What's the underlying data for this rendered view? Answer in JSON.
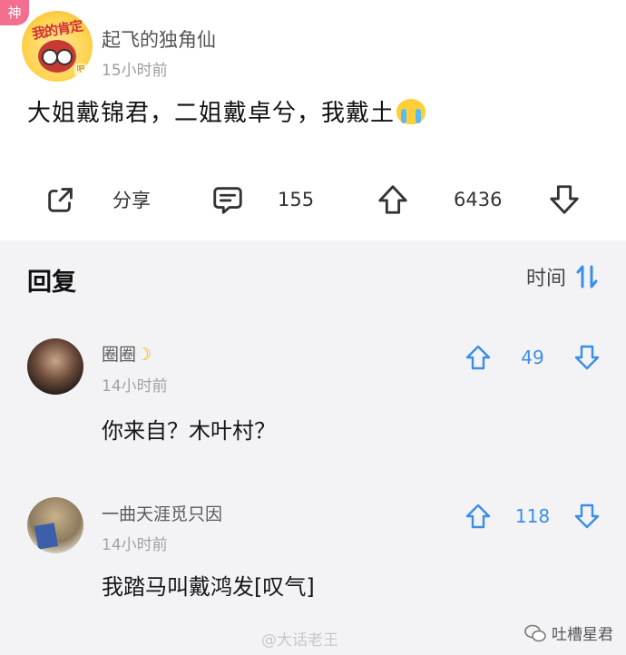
{
  "post": {
    "badge": "神",
    "avatar_ribbon": "我的肯定",
    "author": "起飞的独角仙",
    "time": "15小时前",
    "text": "大姐戴锦君，二姐戴卓兮，我戴土",
    "emoji": "crying-face-icon"
  },
  "actions": {
    "share_label": "分享",
    "comment_count": "155",
    "upvote_count": "6436"
  },
  "replies": {
    "title": "回复",
    "sort_label": "时间",
    "items": [
      {
        "name": "圈圈",
        "time": "14小时前",
        "text": "你来自？木叶村？",
        "votes": "49"
      },
      {
        "name": "一曲天涯觅只因",
        "time": "14小时前",
        "text": "我踏马叫戴鸿发[叹气]",
        "votes": "118"
      }
    ]
  },
  "watermark": "@大话老王",
  "wechat": "吐槽星君",
  "colors": {
    "accent": "#3a8ee6",
    "badge": "#f36f8f",
    "reply_bg": "#f3f3f6"
  }
}
